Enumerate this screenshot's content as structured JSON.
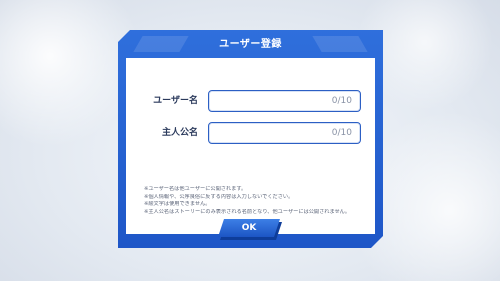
{
  "dialog": {
    "title": "ユーザー登録",
    "fields": [
      {
        "label": "ユーザー名",
        "value": "",
        "counter": "0/10"
      },
      {
        "label": "主人公名",
        "value": "",
        "counter": "0/10"
      }
    ],
    "notes": [
      "※ユーザー名は他ユーザーに公開されます。",
      "※個人情報や、公序良俗に反する内容は入力しないでください。",
      "※絵文字は使用できません。",
      "※主人公名はストーリーにのみ表示される名前となり、他ユーザーには公開されません。"
    ],
    "ok_label": "OK"
  },
  "colors": {
    "accent": "#1e56c7",
    "frame": "#2f6fdc",
    "input_border": "#2c5fc4"
  }
}
